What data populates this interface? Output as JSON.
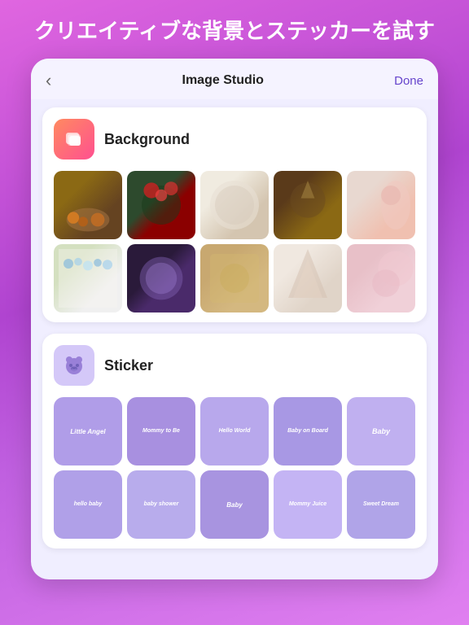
{
  "header": {
    "title": "Image Studio",
    "done_label": "Done",
    "back_icon": "‹"
  },
  "top_text": "クリエイティブな背景とステッカーを試す",
  "background_section": {
    "label": "Background",
    "icon": "🖼"
  },
  "sticker_section": {
    "label": "Sticker",
    "icon": "🐼"
  },
  "stickers": [
    {
      "text": "Little Angel"
    },
    {
      "text": "Mommy to Be"
    },
    {
      "text": "Hello World"
    },
    {
      "text": "Baby on Board"
    },
    {
      "text": "Baby"
    },
    {
      "text": "hello baby"
    },
    {
      "text": "baby shower"
    },
    {
      "text": "Baby"
    },
    {
      "text": "Mommy Juice"
    },
    {
      "text": "Sweet Dream"
    }
  ]
}
